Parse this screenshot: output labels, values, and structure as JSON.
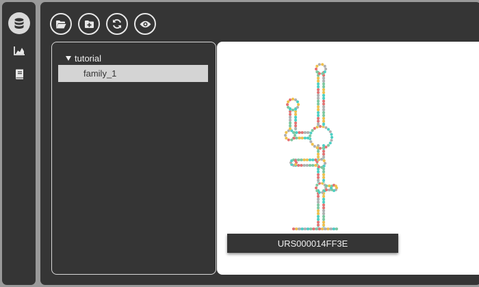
{
  "sidebar": {
    "items": [
      {
        "icon": "database-icon",
        "active": true
      },
      {
        "icon": "area-chart-icon",
        "active": false
      },
      {
        "icon": "book-icon",
        "active": false
      }
    ]
  },
  "toolbar": {
    "buttons": [
      {
        "icon": "open-folder-icon"
      },
      {
        "icon": "new-folder-icon"
      },
      {
        "icon": "refresh-icon"
      },
      {
        "icon": "eye-icon"
      }
    ]
  },
  "tree": {
    "root_label": "tutorial",
    "items": [
      {
        "label": "family_1",
        "selected": true
      }
    ]
  },
  "viewer": {
    "structure_label": "URS000014FF3E",
    "palette": [
      "#e57373",
      "#4dd0c4",
      "#f0c04c",
      "#7ec8a0",
      "#b0b0b0"
    ]
  }
}
